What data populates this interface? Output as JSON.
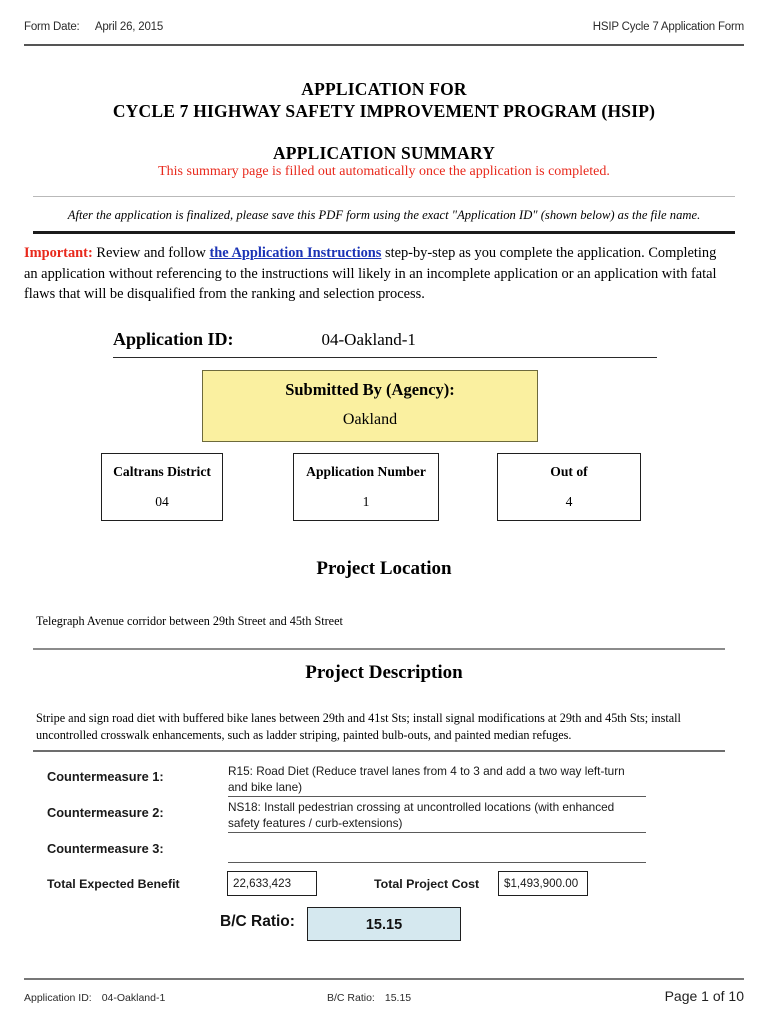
{
  "header": {
    "form_date_label": "Form Date:",
    "form_date_value": "April 26, 2015",
    "right_title": "HSIP Cycle 7 Application Form"
  },
  "titles": {
    "line1": "APPLICATION FOR",
    "line2": "CYCLE 7 HIGHWAY SAFETY IMPROVEMENT PROGRAM (HSIP)",
    "summary": "APPLICATION SUMMARY",
    "summary_note": "This summary page is filled out automatically once the application is completed.",
    "summary_note_color": "#e8291c"
  },
  "notice": {
    "text": "After the application is finalized, please save this PDF form using the exact \"Application ID\" (shown below) as the file name."
  },
  "important": {
    "label": "Important:",
    "label_color": "#e8291c",
    "text_before_link": " Review and follow ",
    "link_text": "the Application Instructions",
    "link_color": "#1b33b5",
    "text_after_link": " step-by-step as you complete the application. Completing an application without referencing to the instructions will likely in an incomplete application or an application with fatal flaws that will be disqualified from the ranking and selection process."
  },
  "application": {
    "id_label": "Application ID:",
    "id_value": "04-Oakland-1",
    "agency_label": "Submitted By (Agency):",
    "agency_value": "Oakland",
    "agency_box_color": "#faf0a0",
    "boxes": [
      {
        "label": "Caltrans District",
        "value": "04"
      },
      {
        "label": "Application Number",
        "value": "1"
      },
      {
        "label": "Out of",
        "value": "4"
      }
    ]
  },
  "project_location": {
    "title": "Project Location",
    "text": "Telegraph Avenue corridor between 29th Street and 45th Street"
  },
  "project_description": {
    "title": "Project Description",
    "text": "Stripe and sign road diet with buffered bike lanes between 29th and 41st Sts; install signal modifications at 29th and 45th Sts; install uncontrolled crosswalk enhancements, such as ladder striping, painted bulb-outs, and painted median refuges."
  },
  "countermeasures": [
    {
      "label": "Countermeasure 1:",
      "value": "R15: Road Diet (Reduce travel lanes from 4 to 3 and add a two way left-turn and bike lane)"
    },
    {
      "label": "Countermeasure 2:",
      "value": "NS18: Install pedestrian crossing at uncontrolled locations (with enhanced safety features / curb-extensions)"
    },
    {
      "label": "Countermeasure 3:",
      "value": ""
    }
  ],
  "benefit_cost": {
    "total_benefit_label": "Total Expected Benefit",
    "total_benefit_value": "22,633,423",
    "total_cost_label": "Total Project Cost",
    "total_cost_value": "$1,493,900.00",
    "bc_ratio_label": "B/C Ratio:",
    "bc_ratio_value": "15.15",
    "bc_box_color": "#d5e8ef"
  },
  "footer": {
    "app_id_label": "Application ID:",
    "app_id_value": "04-Oakland-1",
    "bc_label": "B/C Ratio:",
    "bc_value": "15.15",
    "page": "Page 1 of 10"
  }
}
